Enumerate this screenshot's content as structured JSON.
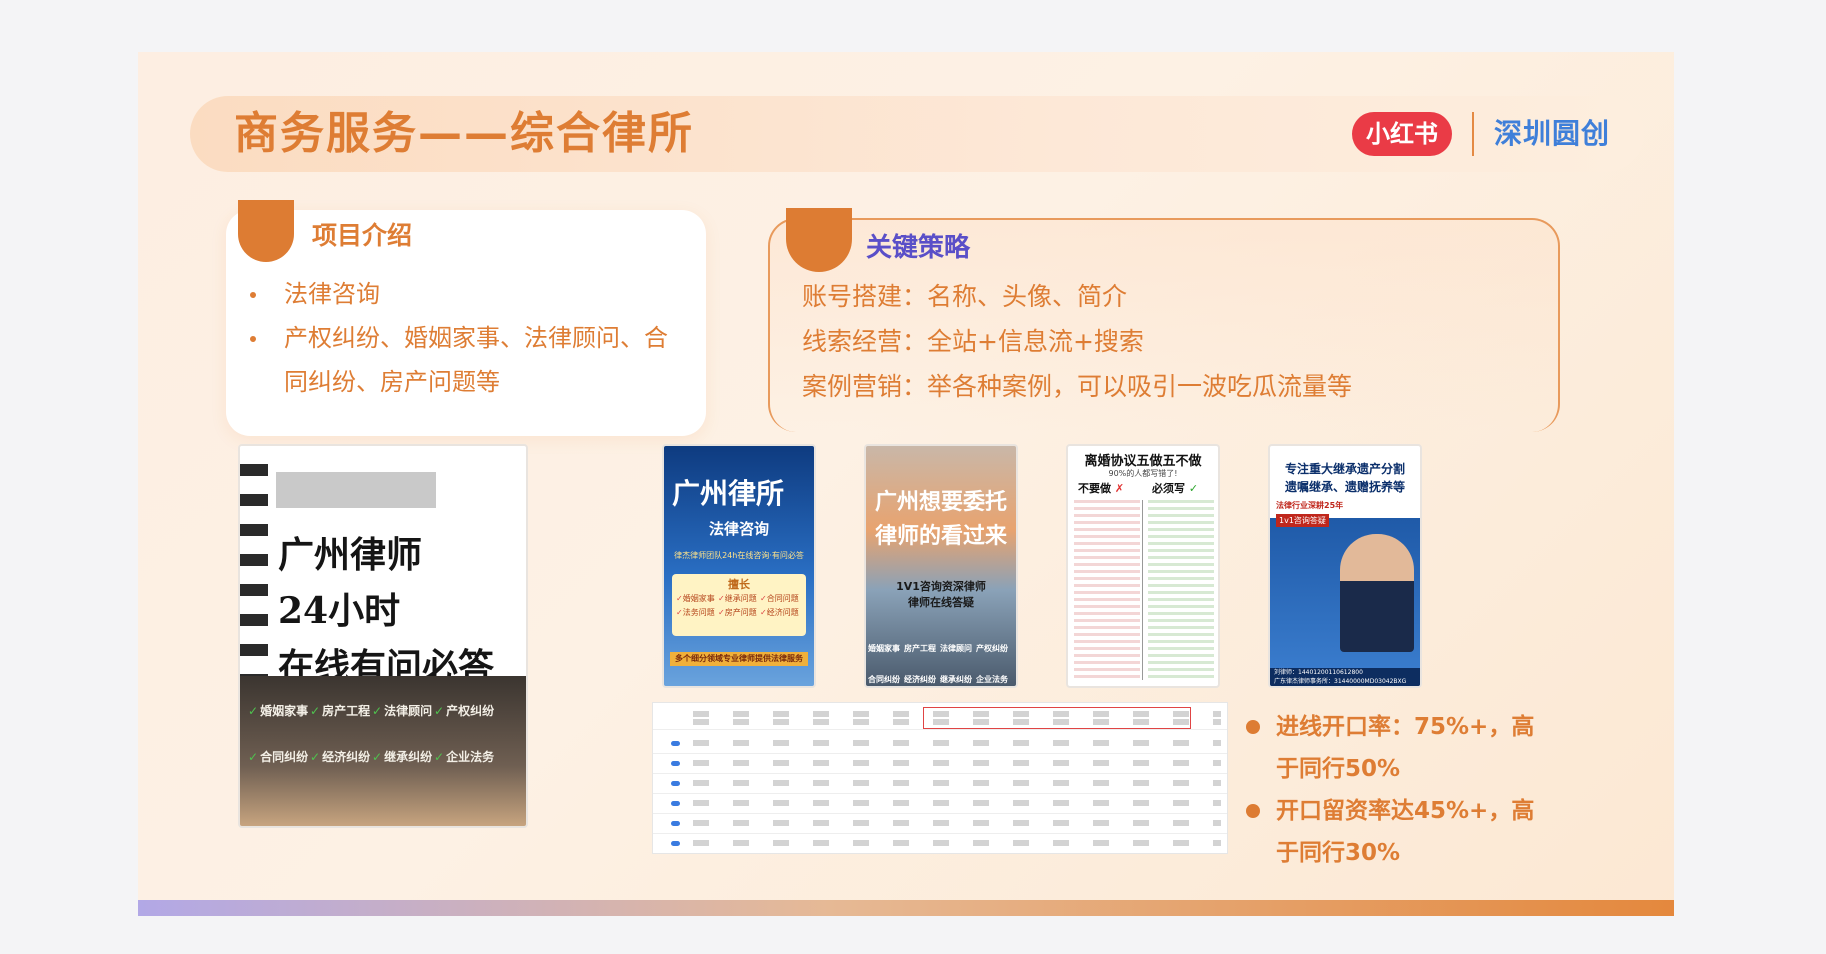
{
  "header": {
    "title": "商务服务——综合律所",
    "logo_text": "小红书",
    "brand": "深圳圆创"
  },
  "intro": {
    "title": "项目介绍",
    "items": [
      "法律咨询",
      "产权纠纷、婚姻家事、法律顾问、合同纠纷、房产问题等"
    ]
  },
  "strategy": {
    "title": "关键策略",
    "lines": [
      "账号搭建：名称、头像、简介",
      "线索经营：全站+信息流+搜索",
      "案例营销：举各种案例，可以吸引一波吃瓜流量等"
    ]
  },
  "poster_main": {
    "lines": [
      "广州律师",
      "24小时",
      "在线有问必答"
    ],
    "tags": [
      "婚姻家事",
      "房产工程",
      "法律顾问",
      "产权纠纷",
      "合同纠纷",
      "经济纠纷",
      "继承纠纷",
      "企业法务"
    ]
  },
  "poster_1": {
    "title": "广州律所",
    "subtitle": "法律咨询",
    "tagline": "律杰律师团队24h在线咨询·有问必答",
    "box_title": "擅长",
    "box_items": [
      "婚姻家事",
      "继承问题",
      "合同问题",
      "法务问题",
      "房产问题",
      "经济问题"
    ],
    "footer": "多个细分领域专业律师提供法律服务"
  },
  "poster_2": {
    "line1": "广州想要委托",
    "line2": "律师的看过来",
    "line3": "1V1咨询资深律师",
    "line4": "律师在线答疑",
    "tags": [
      "婚姻家事",
      "房产工程",
      "法律顾问",
      "产权纠纷",
      "合同纠纷",
      "经济纠纷",
      "继承纠纷",
      "企业法务"
    ]
  },
  "poster_3": {
    "title": "离婚协议五做五不做",
    "subtitle": "90%的人都写错了!",
    "left_head": "不要做",
    "right_head": "必须写"
  },
  "poster_4": {
    "line1": "专注重大继承遗产分割",
    "line2": "遗嘱继承、遗赠抚养等",
    "line3": "法律行业深耕25年",
    "line4": "1v1咨询答疑",
    "footer_1": "刘律师：14401200110612800",
    "footer_2": "广东律杰律师事务所：31440000MD03042BXG"
  },
  "stats": [
    "进线开口率：75%+，高于同行50%",
    "开口留资率达45%+，高于同行30%"
  ],
  "colors": {
    "accent": "#de7d34",
    "strategy_title": "#5a4fc8",
    "brand_blue": "#3f7fd9",
    "logo_red": "#ea3b46"
  }
}
